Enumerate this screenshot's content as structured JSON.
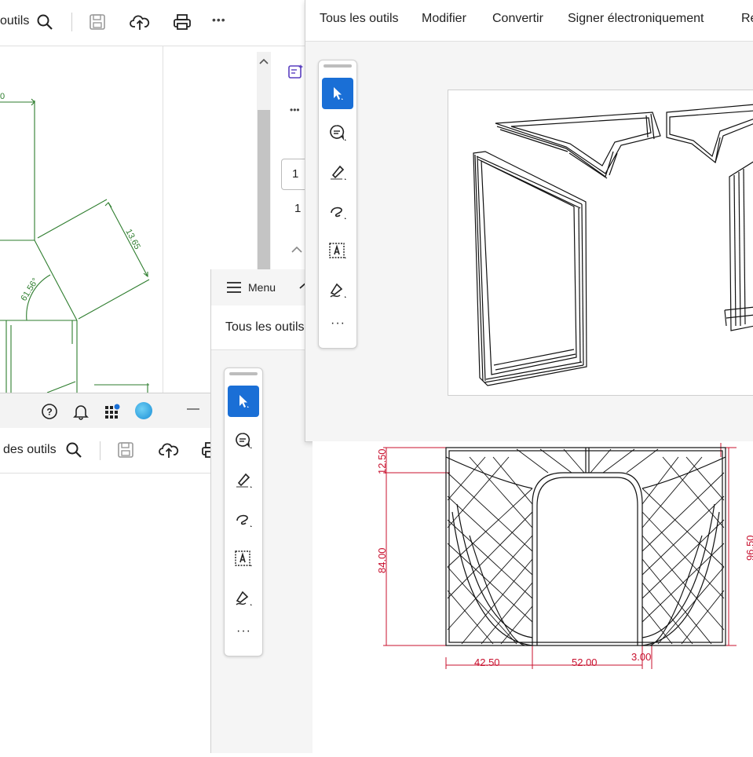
{
  "back_window": {
    "toolbar": {
      "all_tools_partial": "outils",
      "more": "•••"
    },
    "page_number_1": "1",
    "page_number_2": "1",
    "more_dots": "•••",
    "drawing": {
      "dim_top": "0",
      "dim_diag": "13.65",
      "dim_angle": "61.56°"
    }
  },
  "middle_window": {
    "titlebar": {
      "help": "?",
      "minimize": "—"
    },
    "toolbar": {
      "all_tools_partial": "des outils"
    }
  },
  "menu_window": {
    "menu_label": "Menu",
    "all_tools": "Tous les outils",
    "more": "···"
  },
  "front_window": {
    "menu": {
      "all_tools": "Tous les outils",
      "edit": "Modifier",
      "convert": "Convertir",
      "sign": "Signer électroniquement",
      "partial": "Re"
    },
    "more": "···"
  },
  "drawing_bottom": {
    "dim_1250": "12.50",
    "dim_8400": "84.00",
    "dim_9650": "96.50",
    "dim_4250": "42.50",
    "dim_5200": "52.00",
    "dim_300": "3.00"
  },
  "colors": {
    "accent": "#1a6fd6",
    "dimension_red": "#c8102e",
    "drawing_green": "#2e7d2e"
  }
}
